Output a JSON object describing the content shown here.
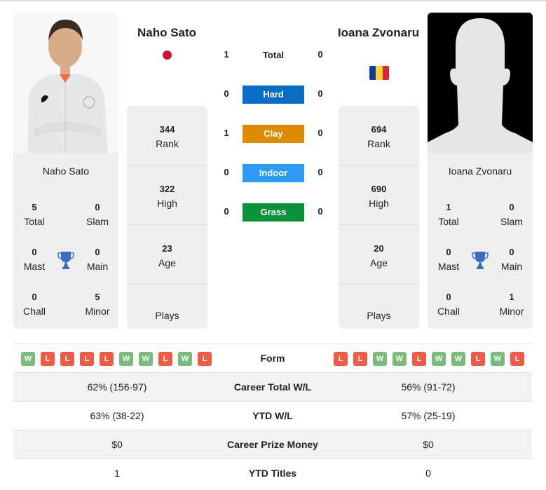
{
  "colors": {
    "hard": "#0a6ec6",
    "clay": "#dd8b00",
    "indoor": "#2c9cf2",
    "grass": "#0b923a",
    "win": "#78bb7b",
    "loss": "#ef5b45",
    "trophy": "#3a6fbf"
  },
  "player1": {
    "name": "Naho Sato",
    "flag": "Japan",
    "card_name": "Naho Sato",
    "titles": [
      {
        "value": "5",
        "label": "Total"
      },
      {
        "value": "0",
        "label": "Slam"
      },
      {
        "value": "0",
        "label": "Mast"
      },
      {
        "value": "0",
        "label": "Main"
      },
      {
        "value": "0",
        "label": "Chall"
      },
      {
        "value": "5",
        "label": "Minor"
      }
    ],
    "rank": {
      "value": "344",
      "label": "Rank"
    },
    "high": {
      "value": "322",
      "label": "High"
    },
    "age": {
      "value": "23",
      "label": "Age"
    },
    "plays": {
      "value": "",
      "label": "Plays"
    },
    "form": [
      "W",
      "L",
      "L",
      "L",
      "L",
      "W",
      "W",
      "L",
      "W",
      "L"
    ]
  },
  "player2": {
    "name": "Ioana Zvonaru",
    "flag": "Romania",
    "card_name": "Ioana Zvonaru",
    "titles": [
      {
        "value": "1",
        "label": "Total"
      },
      {
        "value": "0",
        "label": "Slam"
      },
      {
        "value": "0",
        "label": "Mast"
      },
      {
        "value": "0",
        "label": "Main"
      },
      {
        "value": "0",
        "label": "Chall"
      },
      {
        "value": "1",
        "label": "Minor"
      }
    ],
    "rank": {
      "value": "694",
      "label": "Rank"
    },
    "high": {
      "value": "690",
      "label": "High"
    },
    "age": {
      "value": "20",
      "label": "Age"
    },
    "plays": {
      "value": "",
      "label": "Plays"
    },
    "form": [
      "L",
      "L",
      "W",
      "W",
      "L",
      "W",
      "W",
      "L",
      "W",
      "L"
    ]
  },
  "h2h": [
    {
      "label": "Total",
      "p1": "1",
      "p2": "0"
    },
    {
      "label": "Hard",
      "p1": "0",
      "p2": "0"
    },
    {
      "label": "Clay",
      "p1": "1",
      "p2": "0"
    },
    {
      "label": "Indoor",
      "p1": "0",
      "p2": "0"
    },
    {
      "label": "Grass",
      "p1": "0",
      "p2": "0"
    }
  ],
  "stats": {
    "form_label": "Form",
    "rows": [
      {
        "label": "Career Total W/L",
        "p1": "62% (156-97)",
        "p2": "56% (91-72)"
      },
      {
        "label": "YTD W/L",
        "p1": "63% (38-22)",
        "p2": "57% (25-19)"
      },
      {
        "label": "Career Prize Money",
        "p1": "$0",
        "p2": "$0"
      },
      {
        "label": "YTD Titles",
        "p1": "1",
        "p2": "0"
      }
    ]
  }
}
